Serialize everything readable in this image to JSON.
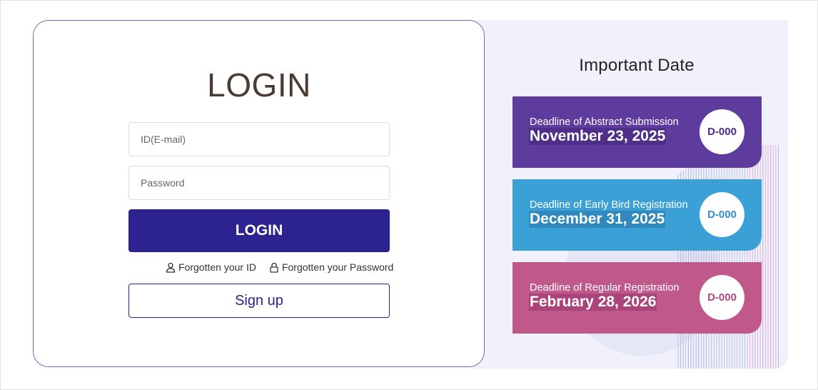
{
  "login": {
    "title": "LOGIN",
    "id_placeholder": "ID(E-mail)",
    "password_placeholder": "Password",
    "login_button": "LOGIN",
    "forgot_id": "Forgotten your ID",
    "forgot_password": "Forgotten your Password",
    "signup_button": "Sign up"
  },
  "important_dates": {
    "title": "Important Date",
    "items": [
      {
        "label": "Deadline of Abstract Submission",
        "date": "November 23, 2025",
        "dday": "D-000",
        "color": "#5e3c9e"
      },
      {
        "label": "Deadline of Early Bird Registration",
        "date": "December 31, 2025",
        "dday": "D-000",
        "color": "#3ba0d6"
      },
      {
        "label": "Deadline of Regular Registration",
        "date": "February 28, 2026",
        "dday": "D-000",
        "color": "#c0588a"
      }
    ]
  },
  "colors": {
    "primary": "#2d2390",
    "panel_bg": "#f1f1fb",
    "card_border": "#6b6bb5"
  }
}
